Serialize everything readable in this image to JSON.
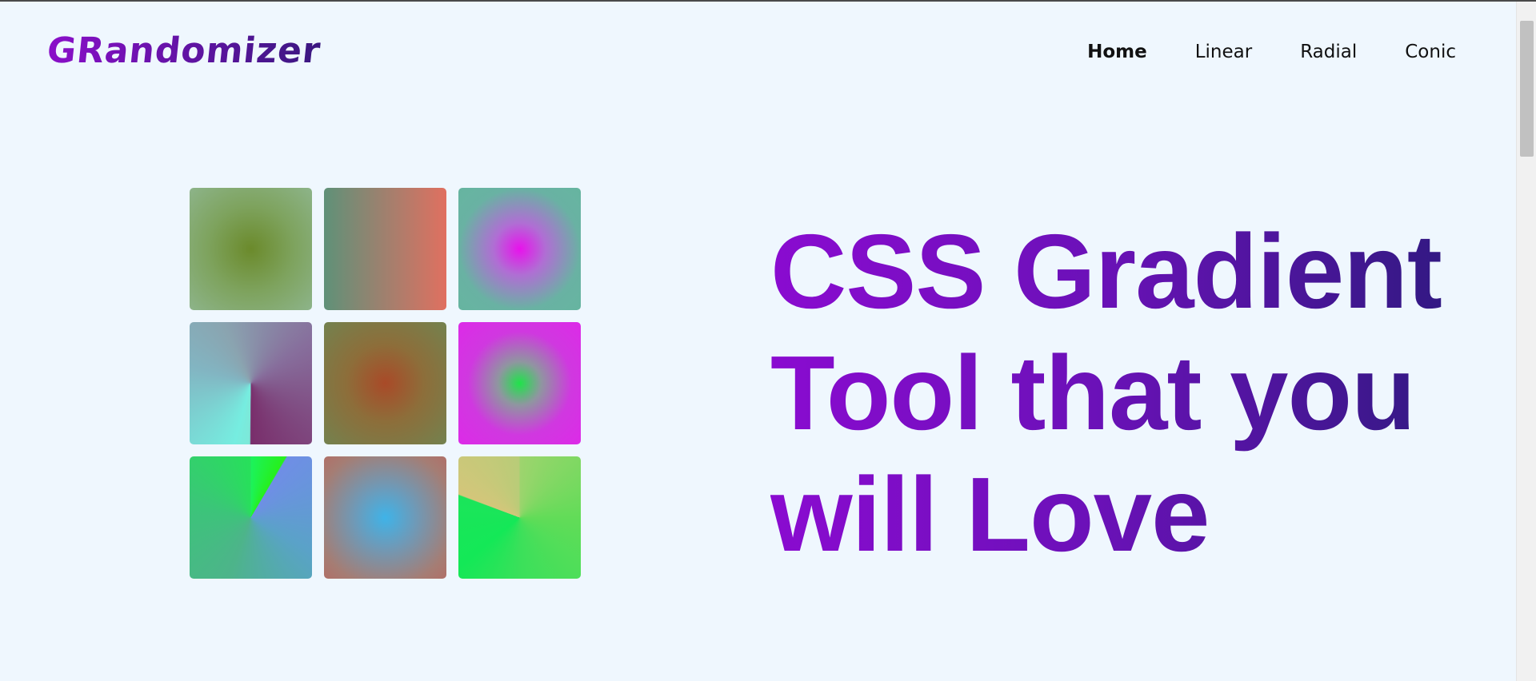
{
  "brand": {
    "logo_text": "GRandomizer"
  },
  "nav": {
    "items": [
      {
        "label": "Home",
        "active": true
      },
      {
        "label": "Linear",
        "active": false
      },
      {
        "label": "Radial",
        "active": false
      },
      {
        "label": "Conic",
        "active": false
      }
    ]
  },
  "hero": {
    "headline_lines": [
      "CSS Gradient",
      "Tool that you",
      "will Love"
    ]
  },
  "gallery": {
    "tiles": [
      {
        "type": "radial"
      },
      {
        "type": "linear"
      },
      {
        "type": "radial"
      },
      {
        "type": "conic"
      },
      {
        "type": "radial"
      },
      {
        "type": "radial"
      },
      {
        "type": "conic"
      },
      {
        "type": "radial"
      },
      {
        "type": "conic"
      }
    ]
  },
  "colors": {
    "background": "#eff7fe",
    "brand_purple": "#7a0fc2",
    "headline_gradient_start": "#8a0bd0",
    "headline_gradient_end": "#2b1a7c"
  }
}
